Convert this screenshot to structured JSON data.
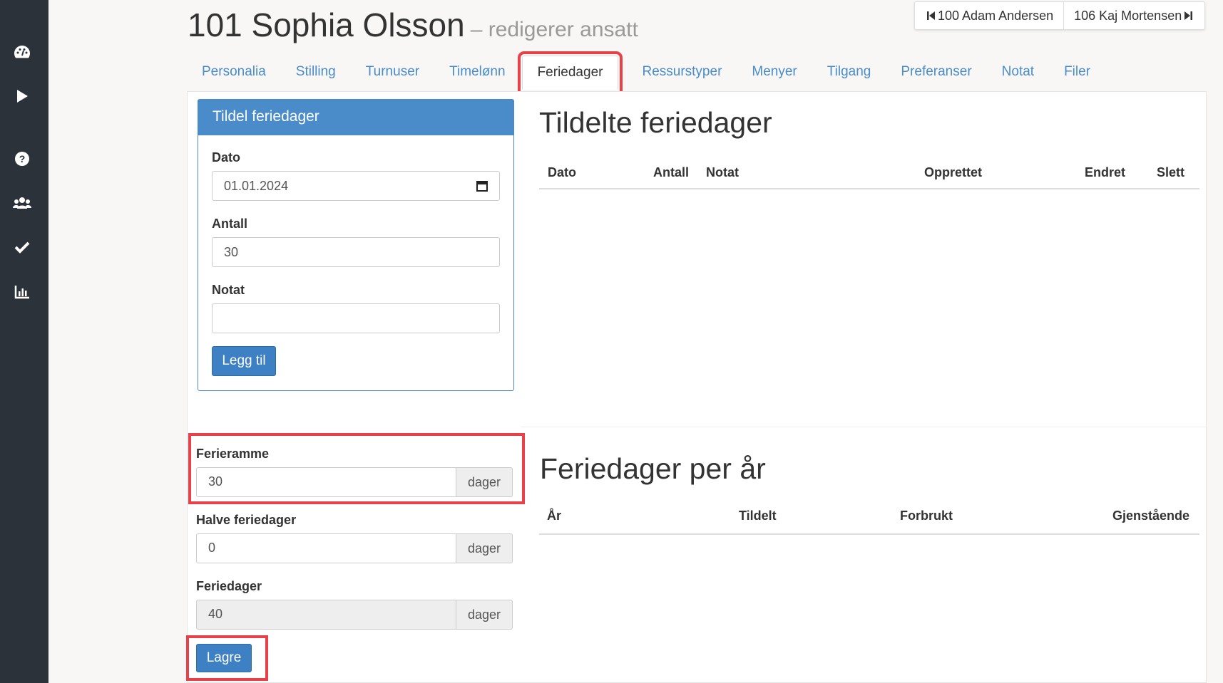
{
  "sidebar": {
    "icons": [
      "dashboard-icon",
      "play-icon",
      "help-icon",
      "users-icon",
      "check-icon",
      "chart-icon"
    ]
  },
  "header": {
    "title": "101 Sophia Olsson",
    "subtitle": "– redigerer ansatt",
    "prev_employee": "100 Adam Andersen",
    "next_employee": "106 Kaj Mortensen"
  },
  "tabs": [
    {
      "label": "Personalia"
    },
    {
      "label": "Stilling"
    },
    {
      "label": "Turnuser"
    },
    {
      "label": "Timelønn"
    },
    {
      "label": "Feriedager",
      "active": true
    },
    {
      "label": "Ressurstyper"
    },
    {
      "label": "Menyer"
    },
    {
      "label": "Tilgang"
    },
    {
      "label": "Preferanser"
    },
    {
      "label": "Notat"
    },
    {
      "label": "Filer"
    }
  ],
  "assign_panel": {
    "title": "Tildel feriedager",
    "date_label": "Dato",
    "date_value": "01.01.2024",
    "amount_label": "Antall",
    "amount_value": "30",
    "note_label": "Notat",
    "note_value": "",
    "add_button": "Legg til"
  },
  "assigned_table": {
    "title": "Tildelte feriedager",
    "columns": [
      "Dato",
      "Antall",
      "Notat",
      "Opprettet",
      "Endret",
      "Slett"
    ],
    "rows": []
  },
  "settings": {
    "frame_label": "Ferieramme",
    "frame_value": "30",
    "half_label": "Halve feriedager",
    "half_value": "0",
    "days_label": "Feriedager",
    "days_value": "40",
    "unit": "dager",
    "save_button": "Lagre"
  },
  "per_year_table": {
    "title": "Feriedager per år",
    "columns": [
      "År",
      "Tildelt",
      "Forbrukt",
      "Gjenstående"
    ],
    "rows": []
  },
  "colors": {
    "sidebar": "#2b323a",
    "primary": "#4a8cca",
    "highlight": "#e8414a"
  }
}
